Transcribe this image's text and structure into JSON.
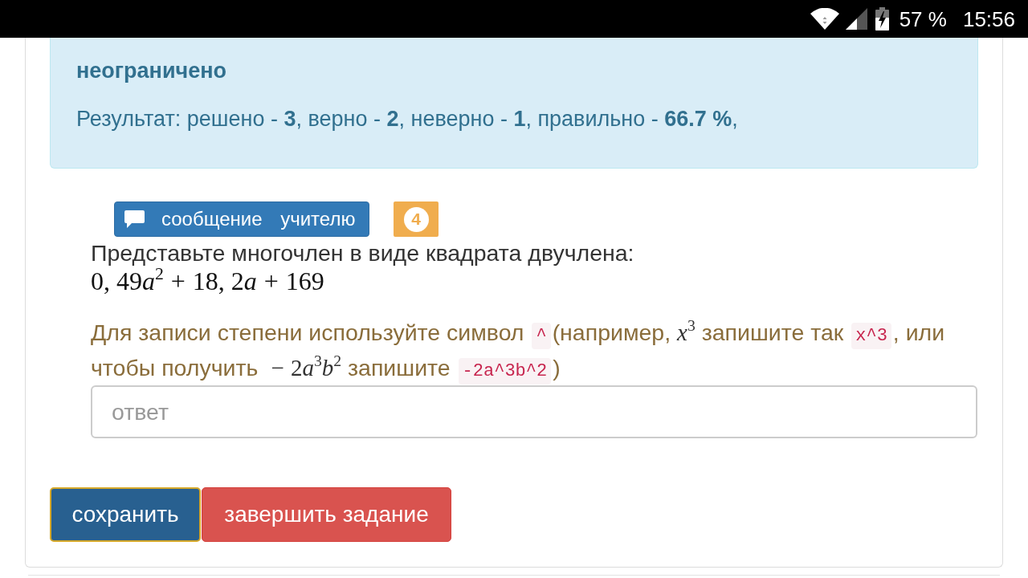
{
  "status_bar": {
    "battery": "57 %",
    "time": "15:56"
  },
  "info_panel": {
    "limit": "неограничено",
    "result": "Результат: решено - **3**, верно - **2**, неверно - **1**, правильно - **66.7 %**,"
  },
  "message_button": {
    "label": "сообщение учителю"
  },
  "task_number": "4",
  "task": {
    "prompt": "Представьте многочлен в виде квадрата двучлена:",
    "expression": [
      {
        "kind": "num",
        "text": "0, 49"
      },
      {
        "kind": "var",
        "text": "a"
      },
      {
        "kind": "pow",
        "text": "2"
      },
      {
        "kind": "op",
        "text": "+"
      },
      {
        "kind": "num",
        "text": "18, 2"
      },
      {
        "kind": "var",
        "text": "a"
      },
      {
        "kind": "op",
        "text": "+"
      },
      {
        "kind": "num",
        "text": "169"
      }
    ]
  },
  "hint": {
    "segments": [
      {
        "kind": "text",
        "text": "Для записи степени используйте символ "
      },
      {
        "kind": "code",
        "text": "^"
      },
      {
        "kind": "text",
        "text": "(например, "
      },
      {
        "kind": "math",
        "parts": [
          {
            "kind": "var",
            "text": "x"
          },
          {
            "kind": "pow",
            "text": "3"
          }
        ]
      },
      {
        "kind": "text",
        "text": " запишите так "
      },
      {
        "kind": "code",
        "text": "x^3"
      },
      {
        "kind": "text",
        "text": ", или чтобы получить "
      },
      {
        "kind": "math",
        "parts": [
          {
            "kind": "op",
            "text": "−"
          },
          {
            "kind": "num",
            "text": "2"
          },
          {
            "kind": "var",
            "text": "a"
          },
          {
            "kind": "pow",
            "text": "3"
          },
          {
            "kind": "var",
            "text": "b"
          },
          {
            "kind": "pow",
            "text": "2"
          }
        ]
      },
      {
        "kind": "text",
        "text": " запишите "
      },
      {
        "kind": "code",
        "text": "-2a^3b^2"
      },
      {
        "kind": "text",
        "text": ")"
      }
    ]
  },
  "answer": {
    "placeholder": "ответ"
  },
  "actions": [
    {
      "kind": "primary",
      "label": "сохранить",
      "focused": true
    },
    {
      "kind": "danger",
      "label": "завершить задание",
      "focused": false
    }
  ]
}
